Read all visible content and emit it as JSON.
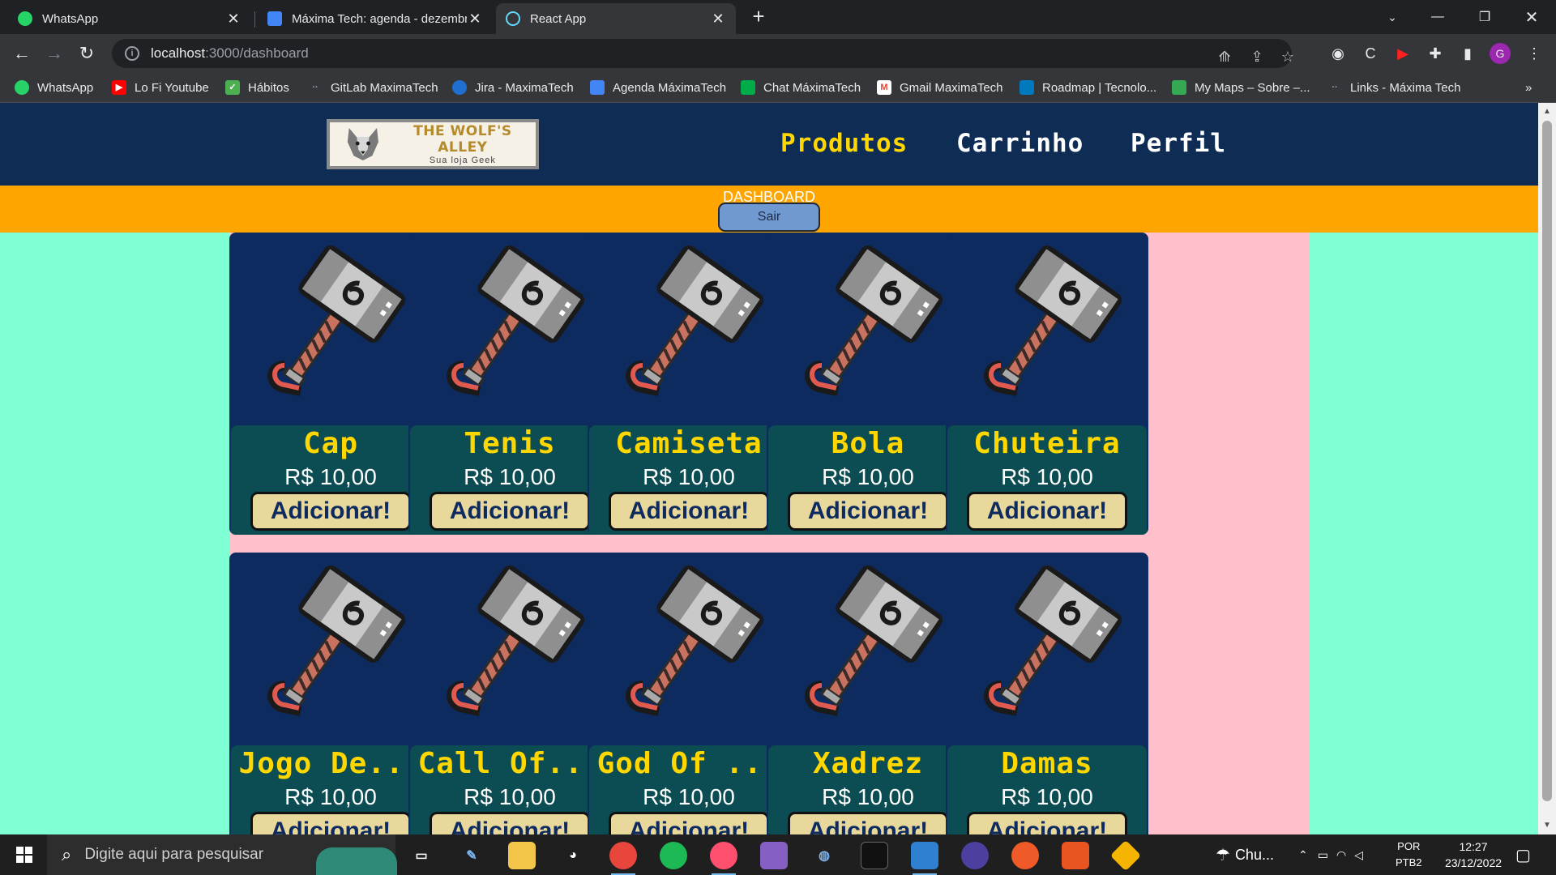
{
  "browser": {
    "tabs": [
      {
        "title": "WhatsApp",
        "active": false
      },
      {
        "title": "Máxima Tech: agenda - dezembro",
        "active": false
      },
      {
        "title": "React App",
        "active": true
      }
    ],
    "url_host": "localhost",
    "url_path": ":3000/dashboard",
    "bookmarks": [
      "WhatsApp",
      "Lo Fi Youtube",
      "Hábitos",
      "GitLab MaximaTech",
      "Jira - MaximaTech",
      "Agenda MáximaTech",
      "Chat MáximaTech",
      "Gmail MaximaTech",
      "Roadmap | Tecnolo...",
      "My Maps – Sobre –...",
      "Links - Máxima Tech"
    ],
    "profile_initial": "G"
  },
  "site": {
    "logo_title": "THE WOLF'S ALLEY",
    "logo_subtitle": "Sua loja Geek",
    "nav": [
      {
        "label": "Produtos",
        "color": "#ffd700"
      },
      {
        "label": "Carrinho",
        "color": "#ffffff"
      },
      {
        "label": "Perfil",
        "color": "#ffffff"
      }
    ],
    "dashboard_title": "DASHBOARD",
    "logout_label": "Sair",
    "add_label": "Adicionar!",
    "products": [
      {
        "name": "Cap",
        "price": "R$ 10,00"
      },
      {
        "name": "Tenis",
        "price": "R$ 10,00"
      },
      {
        "name": "Camiseta",
        "price": "R$ 10,00"
      },
      {
        "name": "Bola",
        "price": "R$ 10,00"
      },
      {
        "name": "Chuteira",
        "price": "R$ 10,00"
      },
      {
        "name": "Jogo De...",
        "price": "R$ 10,00"
      },
      {
        "name": "Call Of...",
        "price": "R$ 10,00"
      },
      {
        "name": "God Of ...",
        "price": "R$ 10,00"
      },
      {
        "name": "Xadrez",
        "price": "R$ 10,00"
      },
      {
        "name": "Damas",
        "price": "R$ 10,00"
      }
    ],
    "colors": {
      "page_bg": "#7fffd4",
      "header_bg": "#0f2c54",
      "dashboard_bar": "#ffa500",
      "grid_bg": "#ffc0cb",
      "card_bg": "#0e2b60",
      "card_info_bg": "#0b4d52",
      "product_name": "#ffd700",
      "add_button": "#e8d89c"
    }
  },
  "taskbar": {
    "search_placeholder": "Digite aqui para pesquisar",
    "weather": "Chu...",
    "lang": "POR",
    "layout": "PTB2",
    "time": "12:27",
    "date": "23/12/2022"
  }
}
